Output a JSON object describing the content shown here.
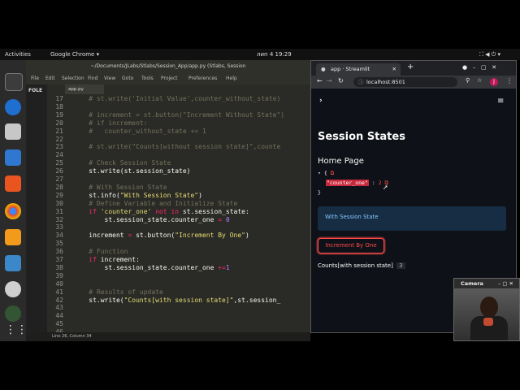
{
  "topbar": {
    "activities": "Activities",
    "app": "Google Chrome ▾",
    "clock": "лип 4  19:29"
  },
  "editor": {
    "title": "~/Documents/JLabs/Stlabs/Session_App/app.py (Stlabs, Session",
    "menu": [
      "File",
      "Edit",
      "Selection",
      "Find",
      "View",
      "Goto",
      "Tools",
      "Project",
      "Preferences",
      "Help"
    ],
    "sidebar_label": "FOLE",
    "tab_name": "app.py",
    "status": "Line 26, Column 34",
    "lines": [
      {
        "n": "17",
        "parts": [
          {
            "t": "    # st.write('Initial Value',counter_without_state)",
            "c": "c"
          }
        ]
      },
      {
        "n": "18",
        "parts": []
      },
      {
        "n": "19",
        "parts": [
          {
            "t": "    # increment = st.button(\"Increment Without State\")",
            "c": "c"
          }
        ]
      },
      {
        "n": "20",
        "parts": [
          {
            "t": "    # if increment:",
            "c": "c"
          }
        ]
      },
      {
        "n": "21",
        "parts": [
          {
            "t": "    #   counter_without_state += 1",
            "c": "c"
          }
        ]
      },
      {
        "n": "22",
        "parts": []
      },
      {
        "n": "23",
        "parts": [
          {
            "t": "    # st.write(\"Counts[without session state]\",counte",
            "c": "c"
          }
        ]
      },
      {
        "n": "24",
        "parts": []
      },
      {
        "n": "25",
        "parts": [
          {
            "t": "    # Check Session State",
            "c": "c"
          }
        ]
      },
      {
        "n": "26",
        "parts": [
          {
            "t": "    st.write(st.session_state)",
            "c": "w"
          }
        ]
      },
      {
        "n": "27",
        "parts": []
      },
      {
        "n": "28",
        "parts": [
          {
            "t": "    # With Session State",
            "c": "c"
          }
        ]
      },
      {
        "n": "29",
        "parts": [
          {
            "t": "    st.info(",
            "c": "w"
          },
          {
            "t": "\"With Session State\"",
            "c": "s"
          },
          {
            "t": ")",
            "c": "w"
          }
        ]
      },
      {
        "n": "30",
        "parts": [
          {
            "t": "    # Define Variable and Initialize State",
            "c": "c"
          }
        ]
      },
      {
        "n": "31",
        "parts": [
          {
            "t": "    ",
            "c": "w"
          },
          {
            "t": "if",
            "c": "k"
          },
          {
            "t": " ",
            "c": "w"
          },
          {
            "t": "'counter_one'",
            "c": "s"
          },
          {
            "t": " ",
            "c": "w"
          },
          {
            "t": "not in",
            "c": "k"
          },
          {
            "t": " st.session_state:",
            "c": "w"
          }
        ]
      },
      {
        "n": "32",
        "parts": [
          {
            "t": "        st.session_state.counter_one ",
            "c": "w"
          },
          {
            "t": "=",
            "c": "k"
          },
          {
            "t": " ",
            "c": "w"
          },
          {
            "t": "0",
            "c": "n"
          }
        ]
      },
      {
        "n": "33",
        "parts": []
      },
      {
        "n": "34",
        "parts": [
          {
            "t": "    increment ",
            "c": "w"
          },
          {
            "t": "=",
            "c": "k"
          },
          {
            "t": " st.button(",
            "c": "w"
          },
          {
            "t": "\"Increment By One\"",
            "c": "s"
          },
          {
            "t": ")",
            "c": "w"
          }
        ]
      },
      {
        "n": "35",
        "parts": []
      },
      {
        "n": "36",
        "parts": [
          {
            "t": "    # Function",
            "c": "c"
          }
        ]
      },
      {
        "n": "37",
        "parts": [
          {
            "t": "    ",
            "c": "w"
          },
          {
            "t": "if",
            "c": "k"
          },
          {
            "t": " increment:",
            "c": "w"
          }
        ]
      },
      {
        "n": "38",
        "parts": [
          {
            "t": "        st.session_state.counter_one ",
            "c": "w"
          },
          {
            "t": "+=",
            "c": "k"
          },
          {
            "t": "1",
            "c": "n"
          }
        ]
      },
      {
        "n": "39",
        "parts": []
      },
      {
        "n": "40",
        "parts": []
      },
      {
        "n": "41",
        "parts": [
          {
            "t": "    # Results of update",
            "c": "c"
          }
        ]
      },
      {
        "n": "42",
        "parts": [
          {
            "t": "    st.write(",
            "c": "w"
          },
          {
            "t": "\"Counts[with session state]\"",
            "c": "s"
          },
          {
            "t": ",st.session_",
            "c": "w"
          }
        ]
      },
      {
        "n": "43",
        "parts": []
      },
      {
        "n": "44",
        "parts": []
      },
      {
        "n": "45",
        "parts": []
      },
      {
        "n": "46",
        "parts": []
      }
    ]
  },
  "browser": {
    "tab_title": "app · Streamlit",
    "url": "localhost:8501",
    "avatar_letter": "J"
  },
  "streamlit": {
    "page_title": "Session States",
    "subheader": "Home Page",
    "json_key": "\"counter_one\"",
    "json_value": "2",
    "info_text": "With Session State",
    "button_label": "Increment By One",
    "result_label": "Counts[with session state]",
    "result_value": "3"
  },
  "camera": {
    "title": "Camera"
  },
  "colors": {
    "accent": "#ff4b4b",
    "info_bg": "#172d43",
    "info_text": "#87c7ff",
    "editor_bg": "#2a2b26"
  }
}
